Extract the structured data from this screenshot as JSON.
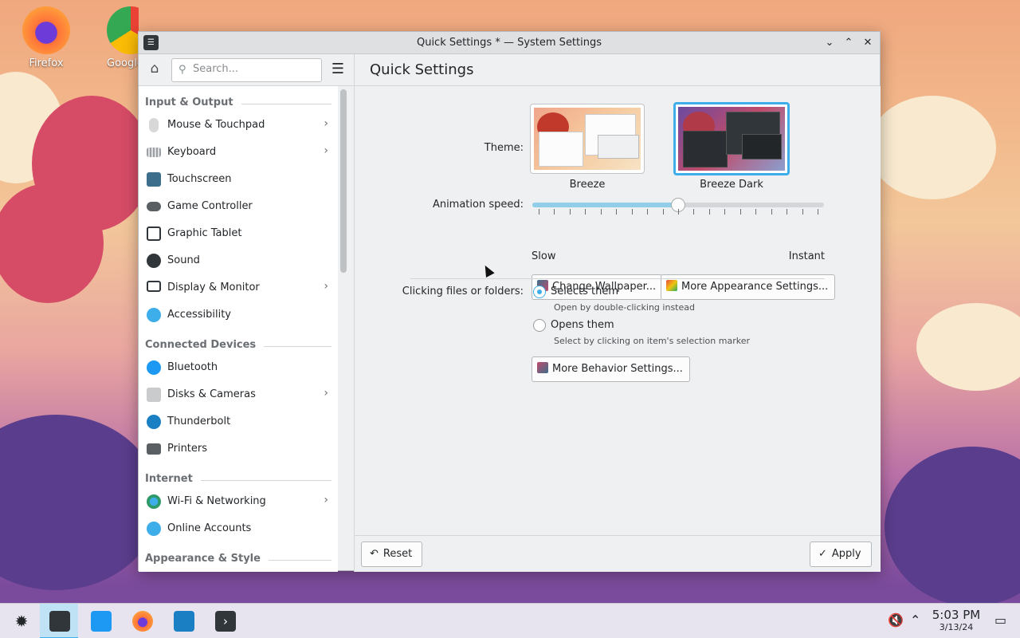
{
  "desktop": {
    "icons": [
      {
        "label": "Firefox"
      },
      {
        "label": "Google"
      }
    ]
  },
  "window": {
    "title": "Quick Settings * — System Settings"
  },
  "toolbar": {
    "search_placeholder": "Search...",
    "page_title": "Quick Settings"
  },
  "sidebar": {
    "sections": [
      {
        "title": "Input & Output",
        "items": [
          {
            "label": "Mouse & Touchpad",
            "chevron": true,
            "color": "#d8d8d8"
          },
          {
            "label": "Keyboard",
            "chevron": true,
            "color": "#9aa0a6"
          },
          {
            "label": "Touchscreen",
            "chevron": false,
            "color": "#3d6f8c"
          },
          {
            "label": "Game Controller",
            "chevron": false,
            "color": "#5a5f63"
          },
          {
            "label": "Graphic Tablet",
            "chevron": false,
            "color": "#31363b"
          },
          {
            "label": "Sound",
            "chevron": false,
            "color": "#31363b"
          },
          {
            "label": "Display & Monitor",
            "chevron": true,
            "color": "#31363b"
          },
          {
            "label": "Accessibility",
            "chevron": false,
            "color": "#3daee9"
          }
        ]
      },
      {
        "title": "Connected Devices",
        "items": [
          {
            "label": "Bluetooth",
            "chevron": false,
            "color": "#1d99f3"
          },
          {
            "label": "Disks & Cameras",
            "chevron": true,
            "color": "#c9cbcd"
          },
          {
            "label": "Thunderbolt",
            "chevron": false,
            "color": "#1b80c3"
          },
          {
            "label": "Printers",
            "chevron": false,
            "color": "#5a5f63"
          }
        ]
      },
      {
        "title": "Internet",
        "items": [
          {
            "label": "Wi-Fi & Networking",
            "chevron": true,
            "color": "#2e9a6a"
          },
          {
            "label": "Online Accounts",
            "chevron": false,
            "color": "#3daee9"
          }
        ]
      },
      {
        "title": "Appearance & Style",
        "items": []
      }
    ]
  },
  "content": {
    "theme_label": "Theme:",
    "themes": [
      {
        "name": "Breeze",
        "selected": false
      },
      {
        "name": "Breeze Dark",
        "selected": true
      }
    ],
    "animation_label": "Animation speed:",
    "animation_value": 0.5,
    "slider_min_label": "Slow",
    "slider_max_label": "Instant",
    "change_wallpaper_label": "Change Wallpaper...",
    "more_appearance_label": "More Appearance Settings...",
    "clicking_label": "Clicking files or folders:",
    "options": [
      {
        "label": "Selects them",
        "desc": "Open by double-clicking instead",
        "checked": true
      },
      {
        "label": "Opens them",
        "desc": "Select by clicking on item's selection marker",
        "checked": false
      }
    ],
    "more_behavior_label": "More Behavior Settings..."
  },
  "footer": {
    "reset_label": "Reset",
    "apply_label": "Apply"
  },
  "taskbar": {
    "time": "5:03 PM",
    "date": "3/13/24"
  }
}
